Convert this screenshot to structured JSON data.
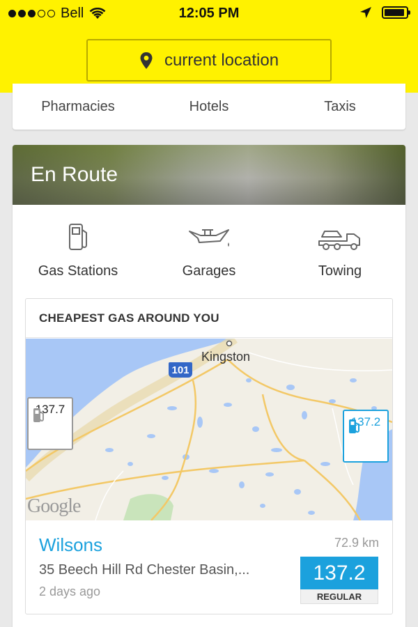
{
  "status_bar": {
    "carrier": "Bell",
    "time": "12:05 PM",
    "signal_full": 3,
    "signal_total": 5
  },
  "location_button": {
    "label": "current location",
    "icon": "map-pin-icon"
  },
  "categories": [
    "Pharmacies",
    "Hotels",
    "Taxis"
  ],
  "en_route": {
    "title": "En Route",
    "services": [
      {
        "label": "Gas Stations",
        "icon": "gas-pump-icon"
      },
      {
        "label": "Garages",
        "icon": "oil-can-icon"
      },
      {
        "label": "Towing",
        "icon": "tow-truck-icon"
      }
    ]
  },
  "cheapest_gas": {
    "title": "CHEAPEST GAS AROUND YOU",
    "map": {
      "city_label": "Kingston",
      "highway_shield": "101",
      "attribution": "Google",
      "pins": [
        {
          "price": "137.7",
          "selected": false
        },
        {
          "price": "137.2",
          "selected": true
        }
      ]
    },
    "station": {
      "name": "Wilsons",
      "distance": "72.9 km",
      "address": "35 Beech Hill Rd Chester Basin,...",
      "updated": "2 days ago",
      "price": "137.2",
      "grade": "REGULAR"
    }
  },
  "colors": {
    "header_yellow": "#fff200",
    "accent_blue": "#1ba1dd",
    "page_bg": "#e9e9e9"
  }
}
